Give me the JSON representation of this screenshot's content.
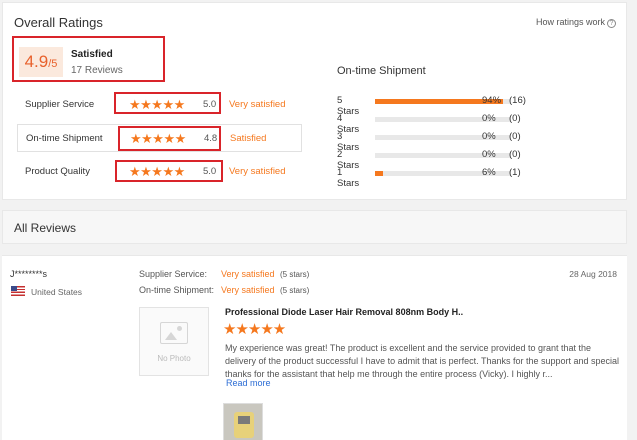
{
  "overall": {
    "title": "Overall Ratings",
    "how_link": "How ratings work",
    "score": "4.9",
    "score_denominator": "/5",
    "satisfaction": "Satisfied",
    "reviews": "17 Reviews",
    "highlight_color": "#d9242a"
  },
  "criteria": [
    {
      "label": "Supplier Service",
      "stars": "★★★★★",
      "value": "5.0",
      "text": "Very satisfied"
    },
    {
      "label": "On-time Shipment",
      "stars": "★★★★★",
      "value": "4.8",
      "text": "Satisfied"
    },
    {
      "label": "Product Quality",
      "stars": "★★★★★",
      "value": "5.0",
      "text": "Very satisfied"
    }
  ],
  "shipment": {
    "title": "On-time Shipment",
    "rows": [
      {
        "label": "5 Stars",
        "pct": "94%",
        "count": "(16)",
        "fill": 0.94
      },
      {
        "label": "4 Stars",
        "pct": "0%",
        "count": "(0)",
        "fill": 0
      },
      {
        "label": "3 Stars",
        "pct": "0%",
        "count": "(0)",
        "fill": 0
      },
      {
        "label": "2 Stars",
        "pct": "0%",
        "count": "(0)",
        "fill": 0
      },
      {
        "label": "1 Stars",
        "pct": "6%",
        "count": "(1)",
        "fill": 0.06
      }
    ]
  },
  "all_reviews": {
    "title": "All Reviews"
  },
  "review": {
    "author": "J********s",
    "country": "United States",
    "date": "28 Aug 2018",
    "supplier_label": "Supplier Service:",
    "supplier_value": "Very satisfied",
    "supplier_stars": "(5 stars)",
    "shipment_label": "On-time Shipment:",
    "shipment_value": "Very satisfied",
    "shipment_stars": "(5 stars)",
    "no_photo": "No Photo",
    "product_title": "Professional Diode Laser Hair Removal 808nm Body H..",
    "stars": "★★★★★",
    "body": "My experience was great! The product is excellent and the service provided to grant that the delivery of the product successful I have to admit that is perfect. Thanks for the support and special thanks for the assistant that help me through the entire process (Vicky). I highly r...",
    "read_more": "Read more"
  },
  "colors": {
    "accent": "#f5781e",
    "link": "#2b6cd4"
  }
}
